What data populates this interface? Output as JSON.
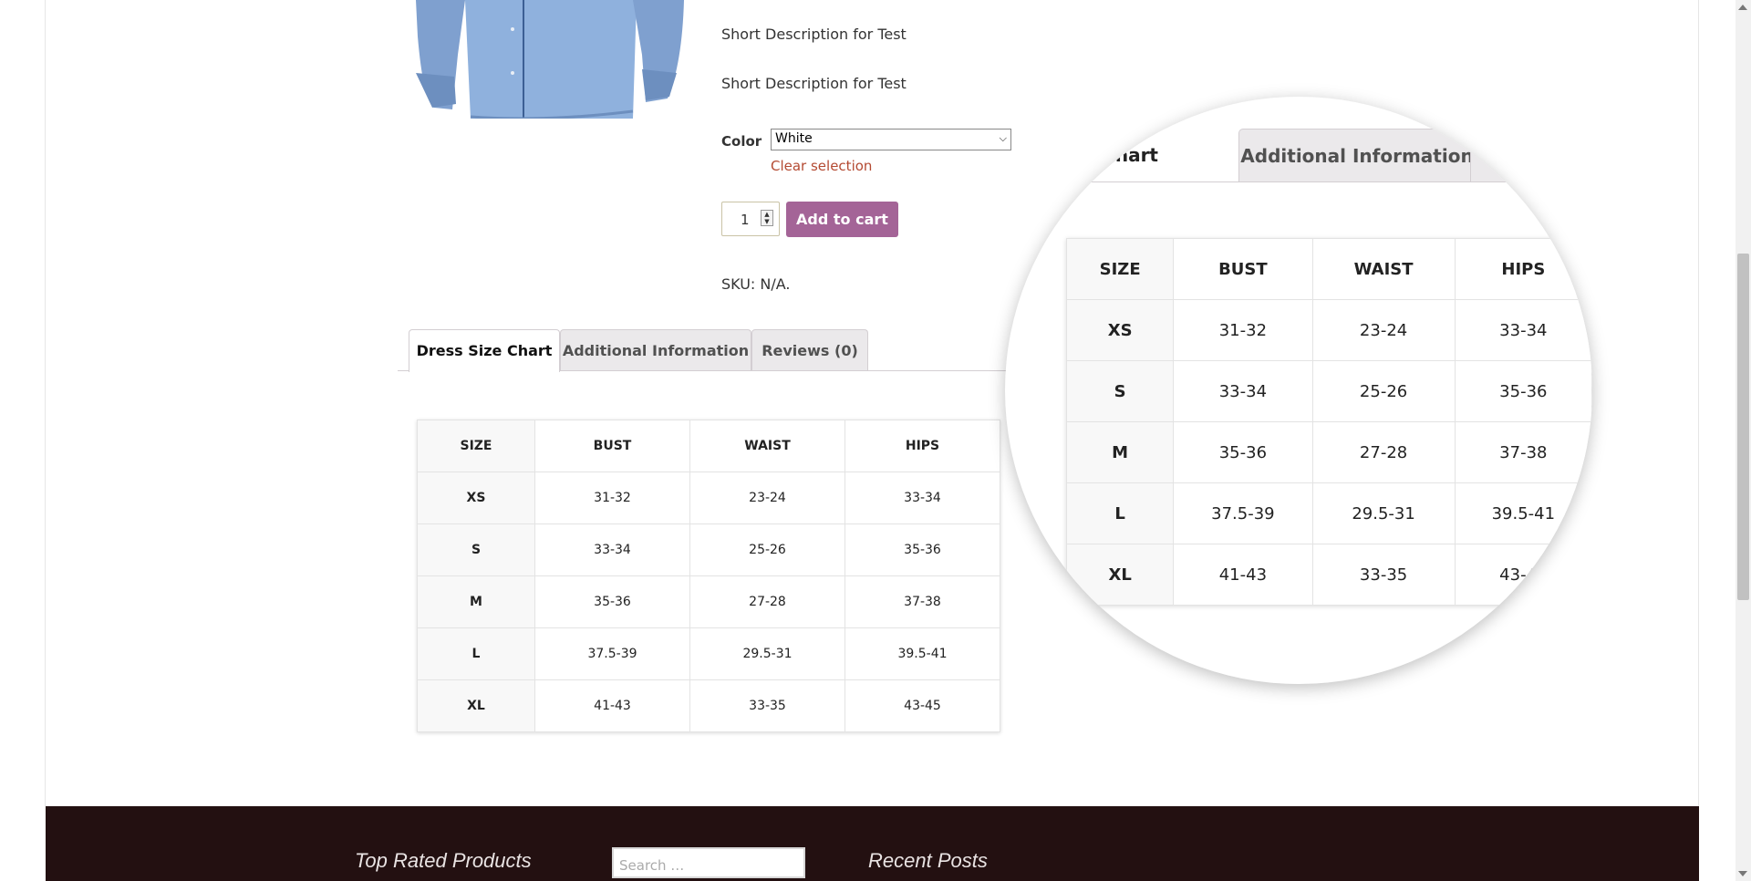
{
  "product": {
    "short_description_1": "Short Description for Test",
    "short_description_2": "Short Description for Test",
    "color_label": "Color",
    "color_selected": "White",
    "clear_selection": "Clear selection",
    "quantity": "1",
    "add_to_cart": "Add to cart",
    "sku": "SKU: N/A."
  },
  "tabs": [
    {
      "label": "Dress Size Chart"
    },
    {
      "label": "Additional Information"
    },
    {
      "label": "Reviews (0)"
    }
  ],
  "size_chart": {
    "headers": [
      "SIZE",
      "BUST",
      "WAIST",
      "HIPS"
    ],
    "rows": [
      [
        "XS",
        "31-32",
        "23-24",
        "33-34"
      ],
      [
        "S",
        "33-34",
        "25-26",
        "35-36"
      ],
      [
        "M",
        "35-36",
        "27-28",
        "37-38"
      ],
      [
        "L",
        "37.5-39",
        "29.5-31",
        "39.5-41"
      ],
      [
        "XL",
        "41-43",
        "33-35",
        "43-45"
      ]
    ]
  },
  "magnifier": {
    "tab_active_partial": "ze Chart",
    "tab_other": "Additional Information"
  },
  "footer": {
    "top_rated_title": "Top Rated Products",
    "search_placeholder": "Search …",
    "recent_posts_title": "Recent Posts"
  },
  "colors": {
    "add_to_cart_bg": "#a46497",
    "clear_selection": "#b44a32",
    "footer_bg": "#231011"
  }
}
